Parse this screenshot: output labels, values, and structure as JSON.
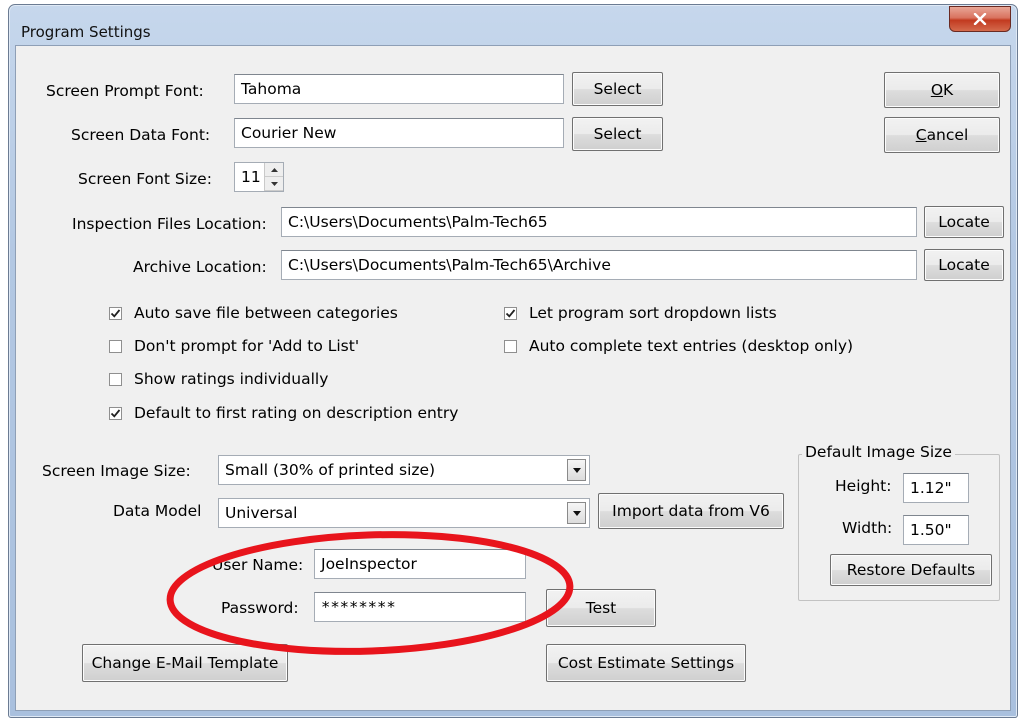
{
  "window": {
    "title": "Program Settings"
  },
  "fonts": {
    "prompt_label": "Screen Prompt Font:",
    "prompt_value": "Tahoma",
    "data_label": "Screen Data Font:",
    "data_value": "Courier New",
    "size_label": "Screen Font Size:",
    "size_value": "11",
    "select_label": "Select"
  },
  "locations": {
    "inspection_label": "Inspection Files Location:",
    "inspection_value": "C:\\Users\\Documents\\Palm-Tech65",
    "archive_label": "Archive Location:",
    "archive_value": "C:\\Users\\Documents\\Palm-Tech65\\Archive",
    "locate_label": "Locate"
  },
  "options": [
    {
      "label": "Auto save file between categories",
      "checked": true
    },
    {
      "label": "Don't prompt for 'Add to List'",
      "checked": false
    },
    {
      "label": "Show ratings individually",
      "checked": false
    },
    {
      "label": "Default to first rating on description entry",
      "checked": true
    },
    {
      "label": "Let program sort dropdown lists",
      "checked": true
    },
    {
      "label": "Auto complete text entries (desktop only)",
      "checked": false
    }
  ],
  "image": {
    "size_label": "Screen Image Size:",
    "size_value": "Small (30% of printed size)",
    "model_label": "Data Model",
    "model_value": "Universal",
    "import_label": "Import data from V6"
  },
  "default_image": {
    "title": "Default Image Size",
    "height_label": "Height:",
    "height_value": "1.12\"",
    "width_label": "Width:",
    "width_value": "1.50\"",
    "restore_label": "Restore Defaults"
  },
  "account": {
    "user_label": "User Name:",
    "user_value": "JoeInspector",
    "password_label": "Password:",
    "password_value": "********",
    "test_label": "Test"
  },
  "buttons": {
    "ok_mnemonic": "O",
    "ok_rest": "K",
    "cancel_mnemonic": "C",
    "cancel_rest": "ancel",
    "email_template": "Change E-Mail Template",
    "cost_estimate": "Cost Estimate Settings"
  },
  "colors": {
    "annotation_ring": "#e8141c"
  },
  "icons": {
    "close": "close-icon",
    "checkmark": "checkmark-icon",
    "dropdown": "chevron-down-icon"
  }
}
